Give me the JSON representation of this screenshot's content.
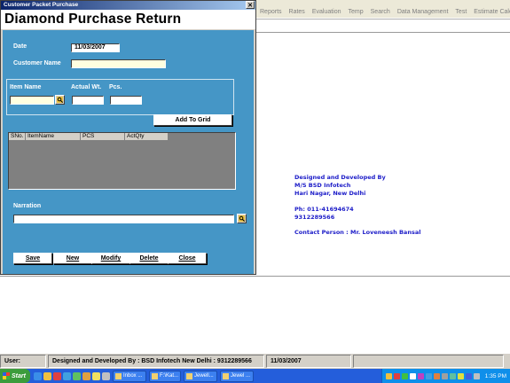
{
  "menubar": [
    "Reports",
    "Rates",
    "Evaluation",
    "Temp",
    "Search",
    "Data Management",
    "Test",
    "Estimate Calculator"
  ],
  "credits": {
    "line1": "Designed and Developed By",
    "line2": "M/S BSD Infotech",
    "line3": "Hari Nagar, New Delhi",
    "phone1": "Ph: 011-41694674",
    "phone2": "9312289566",
    "contact": "Contact Person : Mr. Loveneesh Bansal"
  },
  "window": {
    "title": "Customer Packet Purchase",
    "close_glyph": "✕",
    "heading": "Diamond Purchase Return Voucher......"
  },
  "form": {
    "date_label": "Date",
    "date_value": "11/03/2007",
    "customer_label": "Customer Name",
    "customer_value": "",
    "item_name_label": "Item Name",
    "actual_wt_label": "Actual Wt.",
    "pcs_label": "Pcs.",
    "item_name_value": "",
    "actual_wt_value": "",
    "pcs_value": "",
    "add_to_grid": "Add To Grid",
    "narration_label": "Narration",
    "narration_value": ""
  },
  "grid": {
    "columns": [
      "SNo.",
      "ItemName",
      "PCS",
      "ActQty"
    ]
  },
  "buttons": {
    "save": "Save",
    "new": "New",
    "modify": "Modify",
    "delete": "Delete",
    "close": "Close"
  },
  "statusbar": {
    "user": "User:",
    "designed": "Designed and Developed By : BSD Infotech New Delhi : 9312289566",
    "date": "11/03/2007"
  },
  "taskbar": {
    "start": "Start",
    "tasks": [
      "Inbox ...",
      "F:\\Kat...",
      "Jewell...",
      "Jewel ..."
    ],
    "clock": "1:35 PM"
  },
  "colors": {
    "panel": "#4596c6",
    "credits": "#1c1cc8",
    "input_yellow": "#ffffe0"
  }
}
